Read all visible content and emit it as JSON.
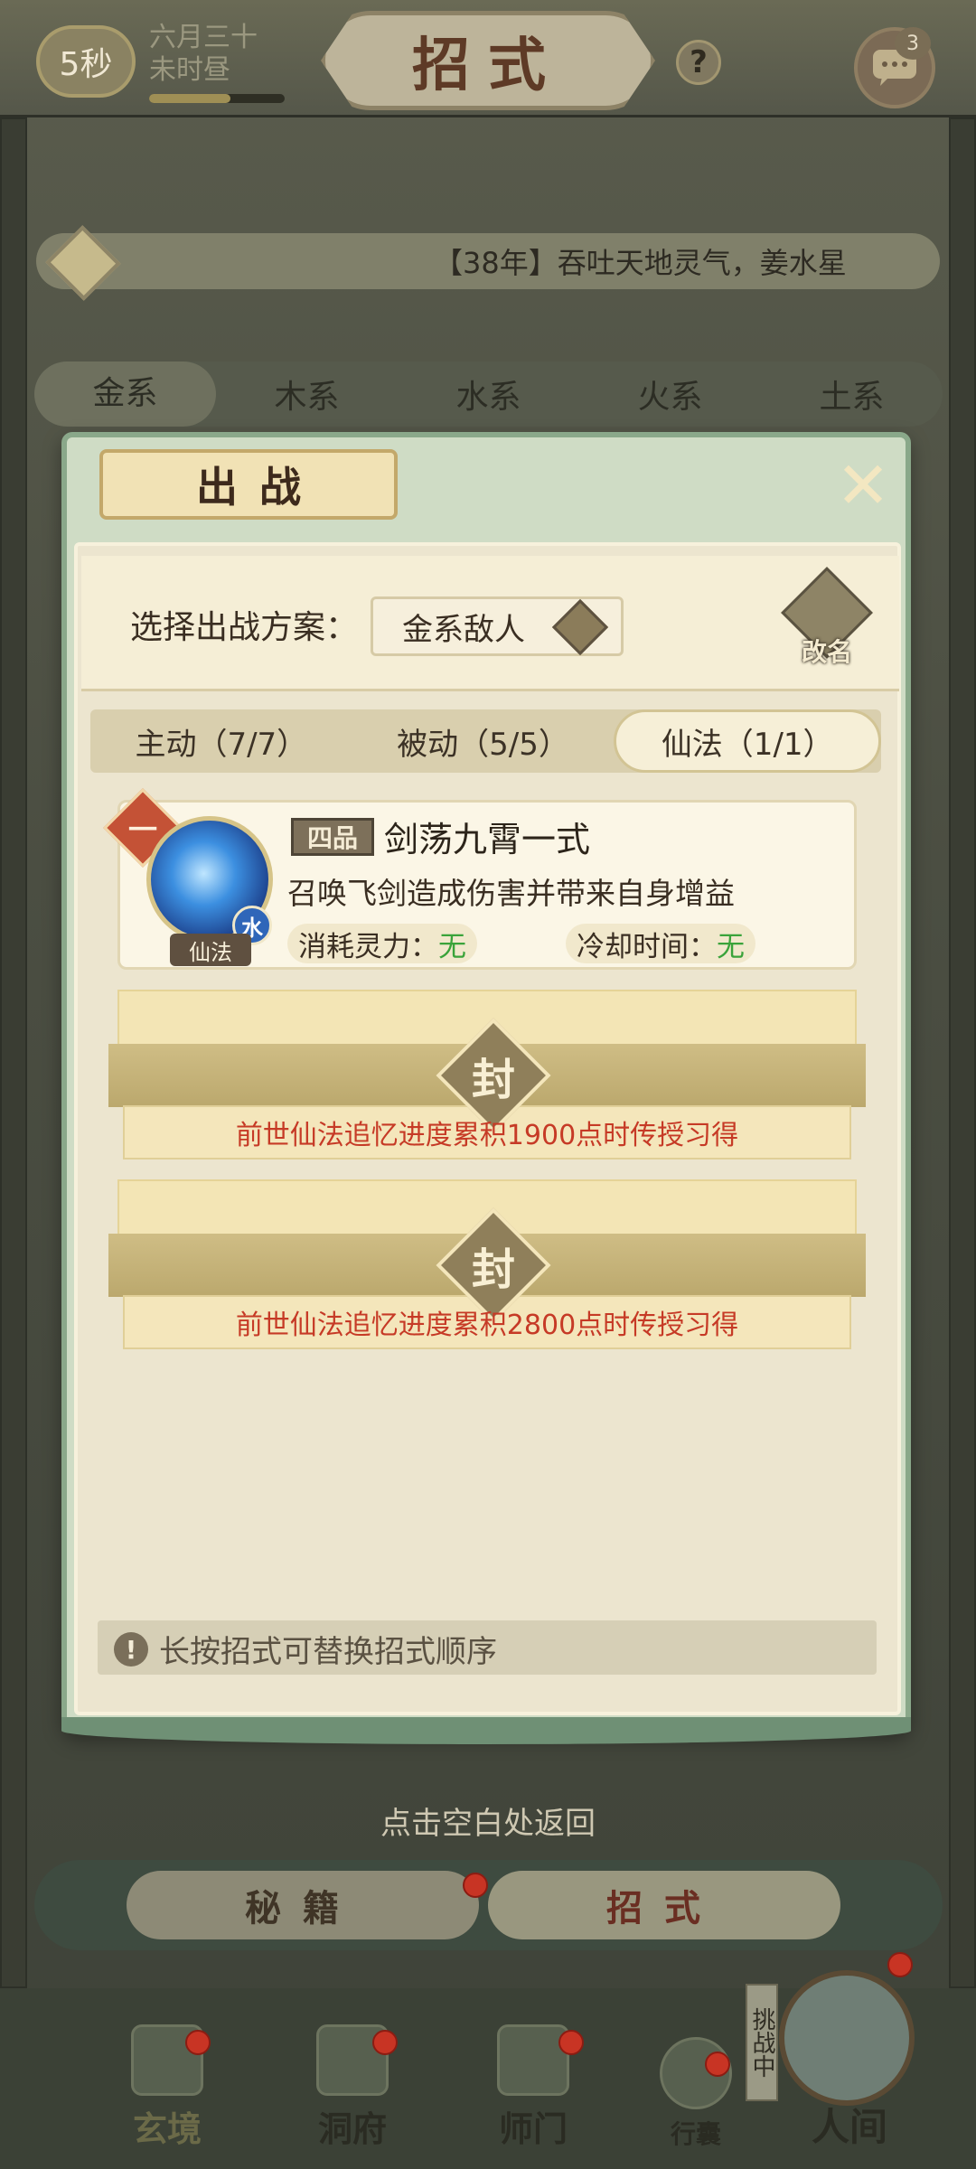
{
  "top_bar": {
    "timer": "5秒",
    "date_line1": "六月三十",
    "date_line2": "未时昼",
    "date_progress": 0.6,
    "title": "招式",
    "help_icon": "question-mark-icon",
    "chat_icon": "chat-bubble-icon",
    "chat_count": "3"
  },
  "announcement": {
    "icon": "bell-icon",
    "text": "【38年】吞吐天地灵气，姜水星"
  },
  "element_tabs": [
    "金系",
    "木系",
    "水系",
    "火系",
    "土系"
  ],
  "dialog": {
    "title": "出战",
    "close_icon": "close-x-icon",
    "plan_label": "选择出战方案：",
    "plan_value": "金系敌人",
    "rename_label": "改名",
    "tabs": [
      "主动（7/7）",
      "被动（5/5）",
      "仙法（1/1）"
    ],
    "active_tab": 2,
    "skill": {
      "slot": "一",
      "grade": "四品",
      "name": "剑荡九霄一式",
      "description": "召唤飞剑造成伤害并带来自身增益",
      "element": "水",
      "type": "仙法",
      "cost_label": "消耗灵力：",
      "cost_value": "无",
      "cooldown_label": "冷却时间：",
      "cooldown_value": "无"
    },
    "locked_slots": [
      {
        "seal": "封",
        "requirement": "前世仙法追忆进度累积1900点时传授习得"
      },
      {
        "seal": "封",
        "requirement": "前世仙法追忆进度累积2800点时传授习得"
      }
    ],
    "tip_icon": "exclamation-icon",
    "tip": "长按招式可替换招式顺序"
  },
  "return_hint": "点击空白处返回",
  "bottom_tabs": [
    "秘籍",
    "招式"
  ],
  "nav": {
    "items": [
      "玄境",
      "洞府",
      "师门",
      "行囊"
    ],
    "world_label": "人间",
    "challenge_tag": "挑战中"
  },
  "colors": {
    "requirement_red": "#c63a26",
    "value_green": "#3aa33a",
    "dialog_green": "#8aa88a"
  }
}
